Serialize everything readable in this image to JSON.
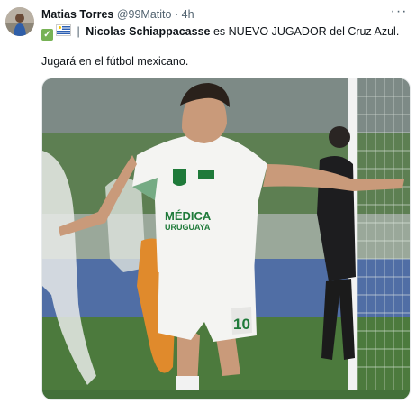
{
  "author": {
    "name": "Matias Torres",
    "handle": "@99Matito",
    "dot": "·",
    "time": "4h",
    "avatar_icon": "profile-photo"
  },
  "menu": {
    "icon": "more-horizontal-icon",
    "label": "···"
  },
  "tweet": {
    "check_icon": "check-mark-button-emoji",
    "flag_icon": "flag-uruguay-emoji",
    "separator": "|",
    "player_name": "Nicolas Schiappacasse",
    "line1_rest": "es NUEVO JUGADOR del Cruz Azul.",
    "line2": "Jugará en el fútbol mexicano."
  },
  "photo": {
    "kit_sponsor_main": "MÉDICA",
    "kit_sponsor_sub": "URUGUAYA",
    "shorts_number": "10",
    "colors": {
      "pitch": "#4c7a3d",
      "kit": "#f4f4f2",
      "kit_green": "#1f7a3a",
      "keeper": "#e08a2c"
    }
  }
}
